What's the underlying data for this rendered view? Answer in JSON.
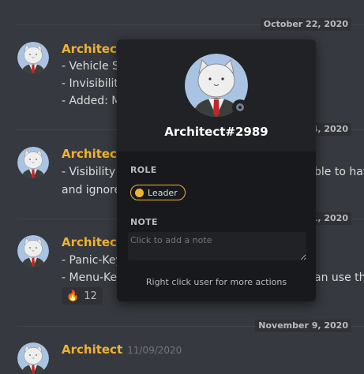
{
  "dates": {
    "d1": "October 22, 2020",
    "d2": "24, 2020",
    "d3": "31, 2020",
    "d4": "November 9, 2020"
  },
  "messages": [
    {
      "author": "Architect",
      "lines": [
        "- Vehicle S",
        "- Invisibility",
        "- Added: M"
      ]
    },
    {
      "author": "Architect",
      "lines": [
        "- Visibility",
        "and ignore"
      ],
      "right_fragment": "ble to hav"
    },
    {
      "author": "Architect",
      "lines": [
        "- Panic-Key",
        "- Menu-Ke"
      ],
      "right_fragment": "an use the",
      "reaction": {
        "emoji": "🔥",
        "count": "12"
      }
    },
    {
      "author": "Architect",
      "timestamp": "11/09/2020"
    }
  ],
  "popout": {
    "username": "Architect#2989",
    "role_title": "ROLE",
    "role": "Leader",
    "note_title": "NOTE",
    "note_placeholder": "Click to add a note",
    "footer": "Right click user for more actions"
  },
  "colors": {
    "accent_author": "#f0b232",
    "background": "#36393f",
    "popout_bg": "#18191c",
    "status_offline": "#747f8d"
  },
  "icons": {
    "avatar": "cat-avatar-icon",
    "status": "offline-status-icon",
    "reaction": "fire-emoji"
  }
}
